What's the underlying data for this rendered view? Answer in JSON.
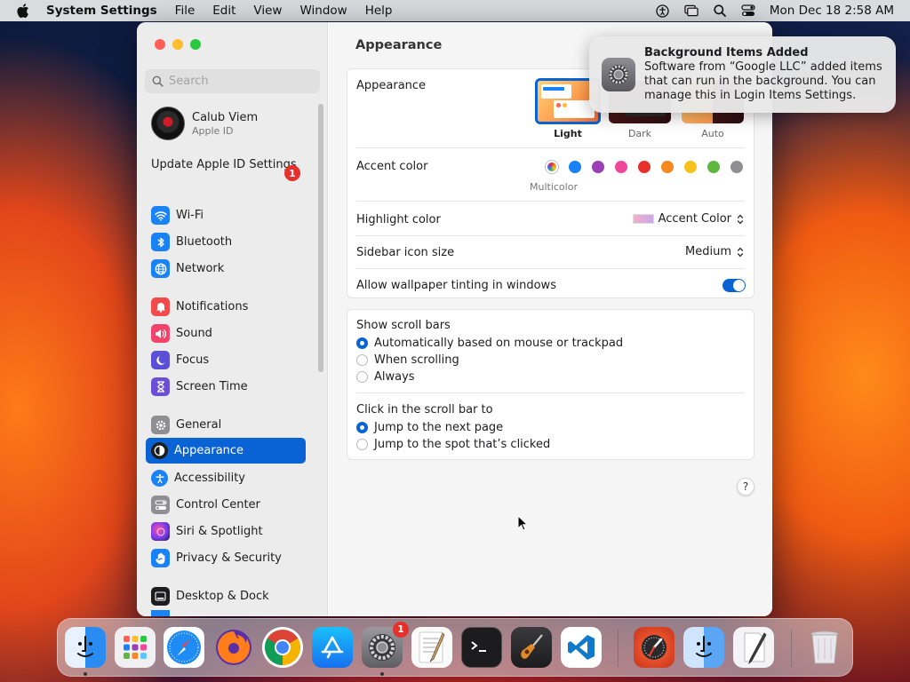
{
  "menubar": {
    "app_name": "System Settings",
    "menus": [
      "File",
      "Edit",
      "View",
      "Window",
      "Help"
    ],
    "clock": "Mon Dec 18  2:58 AM"
  },
  "sidebar": {
    "search_placeholder": "Search",
    "profile": {
      "name": "Calub Viem",
      "subtitle": "Apple ID"
    },
    "update_label": "Update Apple ID Settings",
    "update_badge": "1",
    "items": [
      {
        "label": "Wi-Fi",
        "icon": "wifi-icon",
        "color": "#1a82f7"
      },
      {
        "label": "Bluetooth",
        "icon": "bluetooth-icon",
        "color": "#1a82f7"
      },
      {
        "label": "Network",
        "icon": "globe-icon",
        "color": "#1a82f7"
      },
      {
        "label": "Notifications",
        "icon": "bell-icon",
        "color": "#f24a4a"
      },
      {
        "label": "Sound",
        "icon": "speaker-icon",
        "color": "#f2446a"
      },
      {
        "label": "Focus",
        "icon": "moon-icon",
        "color": "#5a4fd6"
      },
      {
        "label": "Screen Time",
        "icon": "hourglass-icon",
        "color": "#6b4fd6"
      },
      {
        "label": "General",
        "icon": "gear-icon",
        "color": "#8e8e93"
      },
      {
        "label": "Appearance",
        "icon": "appearance-icon",
        "color": "#1d1d1f"
      },
      {
        "label": "Accessibility",
        "icon": "accessibility-icon",
        "color": "#1a82f7"
      },
      {
        "label": "Control Center",
        "icon": "control-center-icon",
        "color": "#8e8e93"
      },
      {
        "label": "Siri & Spotlight",
        "icon": "siri-icon",
        "color": "#b03ad0"
      },
      {
        "label": "Privacy & Security",
        "icon": "hand-icon",
        "color": "#1a82f7"
      },
      {
        "label": "Desktop & Dock",
        "icon": "dock-icon",
        "color": "#1d1d1f"
      }
    ],
    "active_item": "Appearance"
  },
  "content": {
    "title": "Appearance",
    "appearance": {
      "label": "Appearance",
      "options": [
        "Light",
        "Dark",
        "Auto"
      ],
      "selected": "Light"
    },
    "accent": {
      "label": "Accent color",
      "multicolor_label": "Multicolor",
      "colors": [
        "#1a82f7",
        "#9a3fb5",
        "#f0479a",
        "#e5302b",
        "#f5891f",
        "#f7c31b",
        "#5fb83e",
        "#8e8e93"
      ]
    },
    "highlight": {
      "label": "Highlight color",
      "value": "Accent Color"
    },
    "sidebar_icon_size": {
      "label": "Sidebar icon size",
      "value": "Medium"
    },
    "wallpaper_tinting": {
      "label": "Allow wallpaper tinting in windows",
      "enabled": true
    },
    "scroll_bars": {
      "label": "Show scroll bars",
      "options": [
        "Automatically based on mouse or trackpad",
        "When scrolling",
        "Always"
      ],
      "selected": "Automatically based on mouse or trackpad"
    },
    "click_scroll": {
      "label": "Click in the scroll bar to",
      "options": [
        "Jump to the next page",
        "Jump to the spot that’s clicked"
      ],
      "selected": "Jump to the next page"
    },
    "help_label": "?"
  },
  "notification": {
    "title": "Background Items Added",
    "body": "Software from “Google LLC” added items that can run in the background. You can manage this in Login Items Settings."
  },
  "dock": {
    "system_settings_badge": "1"
  }
}
